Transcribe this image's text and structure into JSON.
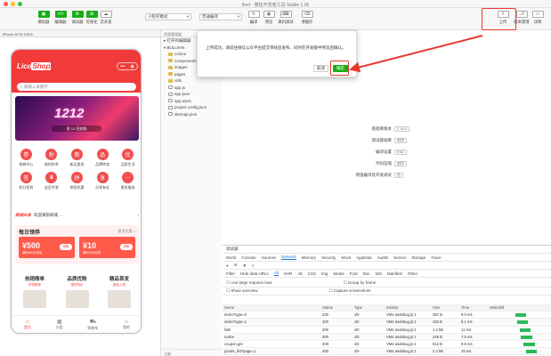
{
  "window": {
    "title": "fleet · 微信开发者工具 Stable 1.06",
    "traffic_lights": [
      "#ff5f56",
      "#ffbd2e",
      "#27c93f"
    ]
  },
  "toolbar": {
    "left_buttons": [
      {
        "label": "模拟器",
        "glyph": "▣"
      },
      {
        "label": "编辑器",
        "glyph": "</>"
      },
      {
        "label": "调试器",
        "glyph": "⚙"
      },
      {
        "label": "可视化",
        "glyph": "⊞"
      },
      {
        "label": "云开发",
        "glyph": "☁"
      }
    ],
    "compile_mode": "小程序模式",
    "compile_select": "普通编译",
    "mid_buttons": [
      {
        "label": "编译",
        "glyph": "↻"
      },
      {
        "label": "预览",
        "glyph": "◉"
      },
      {
        "label": "真机调试",
        "glyph": "⌨"
      },
      {
        "label": "清缓存",
        "glyph": "⌫"
      }
    ],
    "right_buttons": [
      {
        "label": "上传",
        "glyph": "⇪"
      },
      {
        "label": "版本管理",
        "glyph": "⎇"
      },
      {
        "label": "详情",
        "glyph": "▭"
      }
    ]
  },
  "simulator": {
    "device": "iPhone 6/7/8 100%",
    "logo": {
      "prefix": "Lico",
      "suffix": "Shop"
    },
    "capsule": [
      "•••",
      "◉"
    ],
    "search_placeholder": "请输入关键字",
    "banner": {
      "headline": "1212",
      "sub": "双 12 狂欢购"
    },
    "categories": [
      {
        "label": "领券中心",
        "glyph": "券"
      },
      {
        "label": "限时秒杀",
        "glyph": "秒"
      },
      {
        "label": "新品首发",
        "glyph": "新"
      },
      {
        "label": "品牌特卖",
        "glyph": "品"
      },
      {
        "label": "品质生活",
        "glyph": "优"
      },
      {
        "label": "积分签到",
        "glyph": "签"
      },
      {
        "label": "会员专享",
        "glyph": "♛"
      },
      {
        "label": "拼团优惠",
        "glyph": "拼"
      },
      {
        "label": "分享有礼",
        "glyph": "享"
      },
      {
        "label": "更多服务",
        "glyph": "⋯"
      }
    ],
    "news": {
      "tag": "商城头条",
      "text": "欢迎来到商城 ..."
    },
    "daily": {
      "title": "每日领券",
      "more": "更多优惠 >",
      "coupons": [
        {
          "amount": "¥500",
          "desc": "满5000元可用",
          "action": "领取"
        },
        {
          "amount": "¥10",
          "desc": "满100元可用",
          "action": "领取"
        }
      ]
    },
    "promos": [
      {
        "title": "热销榜单",
        "sub": "好物推荐"
      },
      {
        "title": "品质优购",
        "sub": "限时特价"
      },
      {
        "title": "精品首发",
        "sub": "新品上线"
      }
    ],
    "tabs": [
      {
        "label": "首页",
        "glyph": "⌂",
        "active": true
      },
      {
        "label": "分类",
        "glyph": "▦",
        "active": false
      },
      {
        "label": "购物车",
        "glyph": "⛟",
        "active": false
      },
      {
        "label": "我的",
        "glyph": "☺",
        "active": false
      }
    ]
  },
  "explorer": {
    "header": "资源管理器",
    "sections": [
      "打开的编辑器",
      "BULIJIAN"
    ],
    "items": [
      {
        "name": "colorui",
        "type": "folder"
      },
      {
        "name": "components",
        "type": "folder"
      },
      {
        "name": "images",
        "type": "folder"
      },
      {
        "name": "pages",
        "type": "folder"
      },
      {
        "name": "utils",
        "type": "folder"
      },
      {
        "name": "app.js",
        "type": "file"
      },
      {
        "name": "app.json",
        "type": "file"
      },
      {
        "name": "app.wxss",
        "type": "file"
      },
      {
        "name": "project.config.json",
        "type": "file"
      },
      {
        "name": "sitemap.json",
        "type": "file"
      }
    ],
    "footer": "大纲"
  },
  "dialog": {
    "message": "上传成功，请前往微信公众平台提交审核后发布，同时在开发版中预览后确认。",
    "cancel": "取消",
    "confirm": "确定"
  },
  "settings": [
    {
      "key": "基础库版本",
      "value": "2.14.0"
    },
    {
      "key": "调试基础库",
      "value": "启用"
    },
    {
      "key": "编译设置",
      "value": "ES6"
    },
    {
      "key": "代码压缩",
      "value": "启用"
    },
    {
      "key": "增强编译及开发调试",
      "value": "否"
    }
  ],
  "devtools": {
    "title": "调试器",
    "panels": [
      "Wxml",
      "Console",
      "Sources",
      "Network",
      "Memory",
      "Security",
      "Mock",
      "AppData",
      "Audits",
      "Sensor",
      "Storage",
      "Trace"
    ],
    "active_panel": "Network",
    "filter_types": [
      "Filter",
      "Hide data URLs",
      "All",
      "XHR",
      "JS",
      "CSS",
      "Img",
      "Media",
      "Font",
      "Doc",
      "WS",
      "Manifest",
      "Other"
    ],
    "options": [
      "Use large request rows",
      "Group by frame",
      "Show overview",
      "Capture screenshots"
    ],
    "columns": [
      "Name",
      "Status",
      "Type",
      "Initiator",
      "Size",
      "Time",
      "Waterfall"
    ],
    "rows": [
      {
        "name": "index?type=0",
        "status": "200",
        "type": "xhr",
        "initiator": "VM4 asdebug.js:1",
        "size": "387 B",
        "time": "9.0 ms",
        "waterfall": 0.08
      },
      {
        "name": "index?type=1",
        "status": "200",
        "type": "xhr",
        "initiator": "VM4 asdebug.js:1",
        "size": "432 B",
        "time": "8.1 ms",
        "waterfall": 0.15
      },
      {
        "name": "lists",
        "status": "200",
        "type": "xhr",
        "initiator": "VM4 asdebug.js:1",
        "size": "1.2 kB",
        "time": "12 ms",
        "waterfall": 0.25
      },
      {
        "name": "notice",
        "status": "200",
        "type": "xhr",
        "initiator": "VM4 asdebug.js:1",
        "size": "245 B",
        "time": "7.5 ms",
        "waterfall": 0.32
      },
      {
        "name": "coupon.get",
        "status": "200",
        "type": "xhr",
        "initiator": "VM4 asdebug.js:1",
        "size": "512 B",
        "time": "9.8 ms",
        "waterfall": 0.4
      },
      {
        "name": "goods_list?page=1",
        "status": "200",
        "type": "xhr",
        "initiator": "VM4 asdebug.js:1",
        "size": "2.4 kB",
        "time": "15 ms",
        "waterfall": 0.5
      }
    ]
  },
  "accent": {
    "green": "#1aad19",
    "red": "#f23a3a",
    "highlight": "#e8382f"
  }
}
